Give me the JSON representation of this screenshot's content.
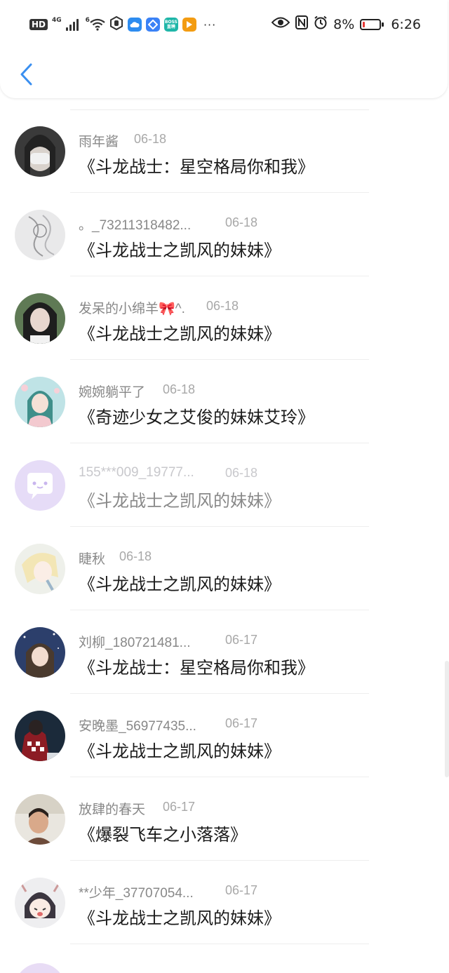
{
  "status_bar": {
    "hd": "HD",
    "network": "4G",
    "wifi_sub": "6",
    "battery_percent": "8%",
    "time": "6:26",
    "icons": [
      "signal-icon",
      "wifi-icon",
      "hexagon-hand-icon",
      "cloud-app-icon",
      "diamond-app-icon",
      "boss-app-icon",
      "video-app-icon",
      "more-dots-icon",
      "eye-icon",
      "nfc-icon",
      "alarm-icon",
      "battery-icon"
    ],
    "boss_label": "BOSS\n直聘",
    "battery_level": 0.08,
    "battery_color": "#e53935"
  },
  "header": {
    "back_icon": "chevron-left-icon",
    "accent_color": "#3a8ff0"
  },
  "items": [
    {
      "name": "雨年酱",
      "date": "06-18",
      "title": "《斗龙战士：星空格局你和我》"
    },
    {
      "name": "。_73211318482...",
      "date": "06-18",
      "title": "《斗龙战士之凯风的妹妹》"
    },
    {
      "name": "发呆的小绵羊🎀^.",
      "date": "06-18",
      "title": "《斗龙战士之凯风的妹妹》"
    },
    {
      "name": "婉婉躺平了",
      "date": "06-18",
      "title": "《奇迹少女之艾俊的妹妹艾玲》"
    },
    {
      "name": "155***009_19777...",
      "date": "06-18",
      "title": "《斗龙战士之凯风的妹妹》"
    },
    {
      "name": "睫秋",
      "date": "06-18",
      "title": "《斗龙战士之凯风的妹妹》"
    },
    {
      "name": "刘柳_180721481...",
      "date": "06-17",
      "title": "《斗龙战士：星空格局你和我》"
    },
    {
      "name": "安晚墨_56977435...",
      "date": "06-17",
      "title": "《斗龙战士之凯风的妹妹》"
    },
    {
      "name": "放肆的春天",
      "date": "06-17",
      "title": "《爆裂飞车之小落落》"
    },
    {
      "name": "**少年_37707054...",
      "date": "06-17",
      "title": "《斗龙战士之凯风的妹妹》"
    }
  ]
}
